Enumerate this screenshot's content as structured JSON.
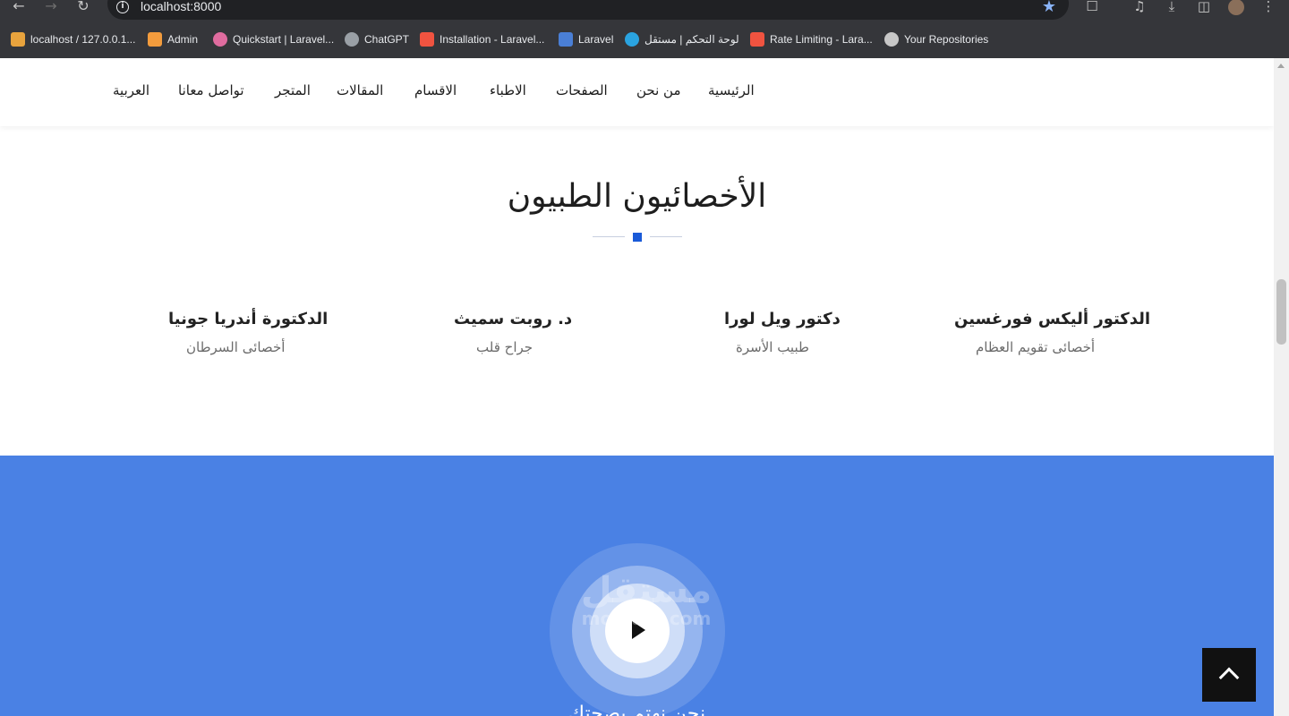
{
  "browser": {
    "url": "localhost:8000",
    "bookmarks": [
      {
        "label": "localhost / 127.0.0.1...",
        "color": "#e8a33d"
      },
      {
        "label": "Admin",
        "color": "#f39c3d"
      },
      {
        "label": "Quickstart | Laravel...",
        "color": "#e06c9f"
      },
      {
        "label": "ChatGPT",
        "color": "#9aa0a6"
      },
      {
        "label": "Installation - Laravel...",
        "color": "#f05340"
      },
      {
        "label": "Laravel",
        "color": "#4a7fd6"
      },
      {
        "label": "لوحة التحكم | مستقل",
        "color": "#2aa3e0"
      },
      {
        "label": "Rate Limiting - Lara...",
        "color": "#f05340"
      },
      {
        "label": "Your Repositories",
        "color": "#c7c7c7"
      }
    ]
  },
  "nav": {
    "items": [
      "الرئيسية",
      "من نحن",
      "الصفحات",
      "الاطباء",
      "الاقسام",
      "المقالات",
      "المتجر",
      "تواصل معانا",
      "العربية"
    ]
  },
  "section": {
    "title": "الأخصائيون الطبيون",
    "accent_color": "#1a5ad8"
  },
  "doctors": [
    {
      "name": "الدكتور أليكس فورغسين",
      "role": "أخصائى تقويم العظام"
    },
    {
      "name": "دكتور ويل لورا",
      "role": "طبيب الأسرة"
    },
    {
      "name": "د. روبت سميث",
      "role": "جراح قلب"
    },
    {
      "name": "الدكتورة أندريا جونيا",
      "role": "أخصائى السرطان"
    }
  ],
  "video_band": {
    "caption": "نحن نهتم بصحتك",
    "color": "#4a81e4"
  },
  "watermark": {
    "arabic": "مستقل",
    "latin": "mostaql.com"
  }
}
